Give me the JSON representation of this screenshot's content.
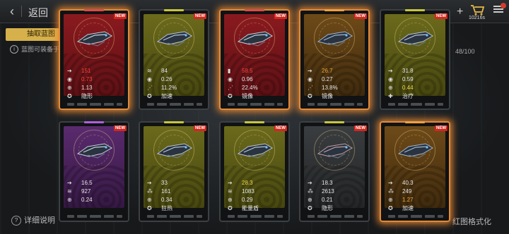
{
  "header": {
    "back_label": "返回",
    "cart_count": "10216s"
  },
  "tab": {
    "label": "抽取蓝图"
  },
  "note": "蓝图可装备于…",
  "page_count": "48/100",
  "footer": {
    "left_label": "详细说明",
    "right_label": "红图格式化"
  },
  "new_label": "NEW",
  "colors": {
    "red": "#8a1a1f",
    "olive": "#6b6a1c",
    "orange": "#6e4a18",
    "purple": "#5a2a6e",
    "glow": "#e08a3a",
    "highlight_red": "#f04a3a",
    "highlight_orange": "#f4a83a",
    "highlight_yellow": "#f0d848"
  },
  "cards": [
    {
      "rarity": "red",
      "glow": true,
      "ship": "heavy-cruiser-icon",
      "stats": [
        {
          "icon": "arrow-icon",
          "value": "151",
          "hl": "red"
        },
        {
          "icon": "target-icon",
          "value": "0.73",
          "hl": "red"
        },
        {
          "icon": "crosshair-icon",
          "value": "1.13",
          "hl": ""
        },
        {
          "icon": "skill-icon",
          "value": "隐形",
          "hl": ""
        }
      ]
    },
    {
      "rarity": "olive",
      "glow": false,
      "ship": "frigate-icon",
      "stats": [
        {
          "icon": "wave-icon",
          "value": "84",
          "hl": ""
        },
        {
          "icon": "target-icon",
          "value": "0.26",
          "hl": ""
        },
        {
          "icon": "spread-icon",
          "value": "11.2%",
          "hl": ""
        },
        {
          "icon": "skill-icon",
          "value": "加速",
          "hl": ""
        }
      ]
    },
    {
      "rarity": "red",
      "glow": true,
      "ship": "carrier-icon",
      "stats": [
        {
          "icon": "bars-icon",
          "value": "58.5",
          "hl": "red"
        },
        {
          "icon": "target-icon",
          "value": "0.96",
          "hl": ""
        },
        {
          "icon": "spread-icon",
          "value": "22.4%",
          "hl": ""
        },
        {
          "icon": "skill-icon",
          "value": "镜像",
          "hl": ""
        }
      ]
    },
    {
      "rarity": "orange",
      "glow": true,
      "ship": "drone-icon",
      "stats": [
        {
          "icon": "arrow-icon",
          "value": "26.7",
          "hl": "orange"
        },
        {
          "icon": "target-icon",
          "value": "0.27",
          "hl": ""
        },
        {
          "icon": "spread-icon",
          "value": "13.8%",
          "hl": ""
        },
        {
          "icon": "skill-icon",
          "value": "镜像",
          "hl": ""
        }
      ]
    },
    {
      "rarity": "olive",
      "glow": false,
      "ship": "interceptor-icon",
      "stats": [
        {
          "icon": "arrow-icon",
          "value": "31.8",
          "hl": ""
        },
        {
          "icon": "target-icon",
          "value": "0.59",
          "hl": ""
        },
        {
          "icon": "crosshair-icon",
          "value": "0.44",
          "hl": "yellow"
        },
        {
          "icon": "heal-icon",
          "value": "治疗",
          "hl": ""
        }
      ]
    },
    {
      "rarity": "purple",
      "glow": false,
      "ship": "fighter-icon",
      "stats": [
        {
          "icon": "arrow-icon",
          "value": "16.5",
          "hl": ""
        },
        {
          "icon": "wave-icon",
          "value": "927",
          "hl": ""
        },
        {
          "icon": "crosshair-icon",
          "value": "0.24",
          "hl": ""
        }
      ]
    },
    {
      "rarity": "olive",
      "glow": false,
      "ship": "scout-icon",
      "stats": [
        {
          "icon": "arrow-icon",
          "value": "33",
          "hl": ""
        },
        {
          "icon": "cluster-icon",
          "value": "161",
          "hl": ""
        },
        {
          "icon": "crosshair-icon",
          "value": "0.34",
          "hl": ""
        },
        {
          "icon": "skill-icon",
          "value": "狂热",
          "hl": ""
        }
      ]
    },
    {
      "rarity": "olive",
      "glow": false,
      "ship": "gunship-icon",
      "stats": [
        {
          "icon": "arrow-icon",
          "value": "28.3",
          "hl": "yellow"
        },
        {
          "icon": "wave-icon",
          "value": "1083",
          "hl": ""
        },
        {
          "icon": "crosshair-icon",
          "value": "0.29",
          "hl": ""
        },
        {
          "icon": "skill-icon",
          "value": "能量盾",
          "hl": ""
        }
      ]
    },
    {
      "rarity": "gray",
      "glow": false,
      "ship": "bomber-icon",
      "stats": [
        {
          "icon": "arrow-icon",
          "value": "18.3",
          "hl": ""
        },
        {
          "icon": "cluster-icon",
          "value": "2613",
          "hl": ""
        },
        {
          "icon": "crosshair-icon",
          "value": "0.21",
          "hl": ""
        },
        {
          "icon": "skill-icon",
          "value": "隐形",
          "hl": ""
        }
      ]
    },
    {
      "rarity": "orange",
      "glow": true,
      "ship": "raider-icon",
      "stats": [
        {
          "icon": "arrow-icon",
          "value": "40.3",
          "hl": ""
        },
        {
          "icon": "cluster-icon",
          "value": "249",
          "hl": ""
        },
        {
          "icon": "crosshair-icon",
          "value": "1.27",
          "hl": "orange"
        },
        {
          "icon": "skill-icon",
          "value": "加速",
          "hl": ""
        }
      ]
    }
  ]
}
